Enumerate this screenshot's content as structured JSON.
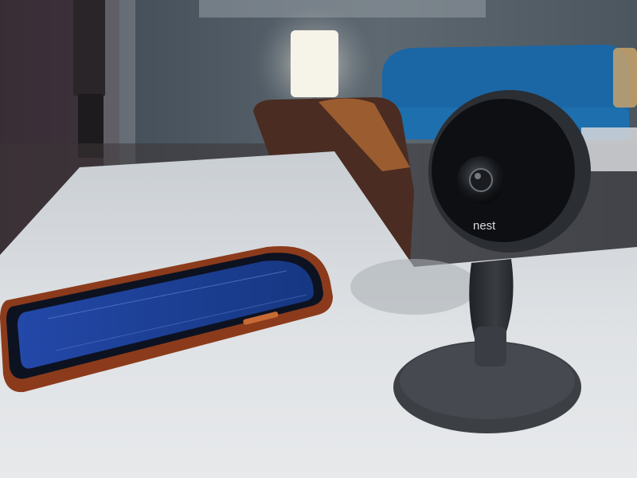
{
  "scene": {
    "camera_brand_text": "nest"
  },
  "colors": {
    "wall": "#3a454f",
    "table_top": "#d7dbdf",
    "sofa": "#1f6fae",
    "lamp_glow": "#f4f2ea",
    "phone_case": "#8a3a1c",
    "phone_screen": "#1c3f92",
    "camera_body": "#2d3035",
    "camera_base": "#3d4146"
  },
  "icons": [
    "lamp",
    "sofa",
    "armchair",
    "smartphone",
    "security-camera"
  ]
}
